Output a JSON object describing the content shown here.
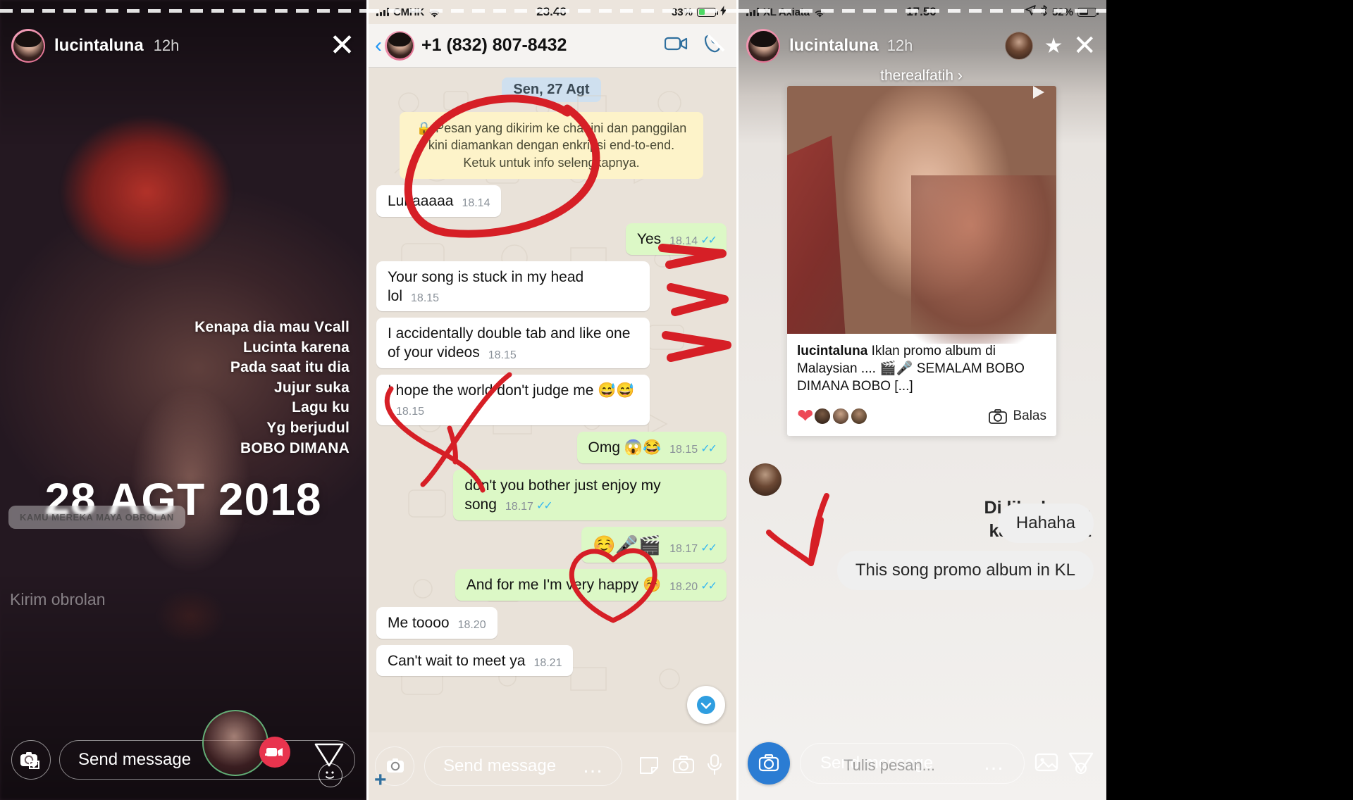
{
  "panel1": {
    "name": "instagram-story",
    "statusbar": {
      "visible": false
    },
    "header": {
      "username": "lucintaluna",
      "time": "12h",
      "close_icon": "close-icon"
    },
    "caption_lines": [
      "Kenapa dia mau Vcall",
      "Lucinta karena",
      "Pada saat itu dia",
      "Jujur suka",
      "Lagu ku",
      "Yg berjudul",
      "BOBO DIMANA"
    ],
    "big_date": "28 AGT 2018",
    "chat_sticker": "KAMU MEREKA MAYA OBROLAN",
    "kirim_label": "Kirim obrolan",
    "footer": {
      "camera_icon": "camera-icon",
      "send_message_placeholder": "Send message",
      "more_icon": "more-dots-icon",
      "video_record_icon": "video-record-icon",
      "share_icon": "paper-plane-icon",
      "emoji_icon": "smiley-icon"
    }
  },
  "panel2": {
    "name": "whatsapp-chat",
    "statusbar": {
      "carrier": "CMHK",
      "wifi_icon": "wifi-icon",
      "time": "23.46",
      "battery_percent": "33%",
      "charging_icon": "lightning-bolt-icon",
      "battery_icon": "battery-icon"
    },
    "header": {
      "back_icon": "back-chevron-icon",
      "contact": "+1 (832) 807-8432",
      "video_call_icon": "video-call-icon",
      "voice_call_icon": "phone-call-icon"
    },
    "date_chip": "Sen, 27 Agt",
    "e2e_notice": "Pesan yang dikirim ke chat ini dan panggilan kini diamankan dengan enkripsi end-to-end. Ketuk untuk info selengkapnya.",
    "lock_icon": "lock-icon",
    "messages": [
      {
        "side": "in",
        "text": "Lunaaaaa",
        "time": "18.14",
        "ticks": false
      },
      {
        "side": "out",
        "text": "Yes",
        "time": "18.14",
        "ticks": true
      },
      {
        "side": "in",
        "text": "Your song is stuck in my head lol",
        "time": "18.15",
        "ticks": false
      },
      {
        "side": "in",
        "text": "I accidentally double tab and like one of your videos",
        "time": "18.15",
        "ticks": false
      },
      {
        "side": "in",
        "text": "I hope the world don't judge me 😅😅",
        "time": "18.15",
        "ticks": false
      },
      {
        "side": "out",
        "text": "Omg 😱😂",
        "time": "18.15",
        "ticks": true
      },
      {
        "side": "out",
        "text": "don't you bother just enjoy my song",
        "time": "18.17",
        "ticks": true
      },
      {
        "side": "out",
        "text": "☺️🎤🎬",
        "time": "18.17",
        "ticks": true
      },
      {
        "side": "out",
        "text": "And for me I'm very happy ☺️",
        "time": "18.20",
        "ticks": true
      },
      {
        "side": "in",
        "text": "Me toooo",
        "time": "18.20",
        "ticks": false
      },
      {
        "side": "in",
        "text": "Can't wait to meet ya",
        "time": "18.21",
        "ticks": false
      }
    ],
    "scroll_down_icon": "chevron-down-icon",
    "footer": {
      "plus_icon": "plus-icon",
      "camera_icon": "camera-icon",
      "send_message_placeholder": "Send message",
      "more_icon": "more-dots-icon",
      "sticker_icon": "sticker-icon",
      "camera2_icon": "camera-icon",
      "mic_icon": "microphone-icon",
      "share_icon": "paper-plane-icon"
    }
  },
  "panel3": {
    "name": "instagram-dm",
    "statusbar": {
      "carrier": "XL Axiata",
      "wifi_icon": "wifi-icon",
      "time": "17.50",
      "location_icon": "location-arrow-icon",
      "bluetooth_icon": "bluetooth-icon",
      "battery_percent": "52%",
      "battery_icon": "battery-icon"
    },
    "header": {
      "username": "lucintaluna",
      "time": "12h",
      "second_user": "therealfatih",
      "chevron_icon": "chevron-right-icon",
      "star_icon": "star-icon",
      "close_icon": "close-icon"
    },
    "shared_post": {
      "author": "lucintaluna",
      "caption": "Iklan promo album di Malaysian .... 🎬🎤 SEMALAM BOBO DIMANA BOBO [...]",
      "play_icon": "play-triangle-icon",
      "like_icon": "heart-filled-icon",
      "reply_label": "Balas",
      "reply_icon": "camera-icon"
    },
    "messages": [
      {
        "style": "dark",
        "lines": [
          "Di like kan ...",
          "karena suka"
        ]
      },
      {
        "style": "grey",
        "text": "Hahaha"
      },
      {
        "style": "grey",
        "text": "This song promo album in KL"
      }
    ],
    "footer": {
      "camera_icon": "camera-icon",
      "send_message_placeholder": "Send message",
      "tulis_placeholder": "Tulis pesan...",
      "more_icon": "more-dots-icon",
      "gallery_icon": "gallery-icon",
      "share_icon": "paper-plane-icon"
    }
  },
  "colors": {
    "whatsapp_out_bubble": "#dcf8c6",
    "whatsapp_in_bubble": "#ffffff",
    "whatsapp_bg": "#e9e2d9",
    "annotation_red": "#d61f26",
    "ig_accent_blue": "#2b7cd3",
    "ig_heart_red": "#ed4956",
    "tick_blue": "#34b7f1"
  }
}
